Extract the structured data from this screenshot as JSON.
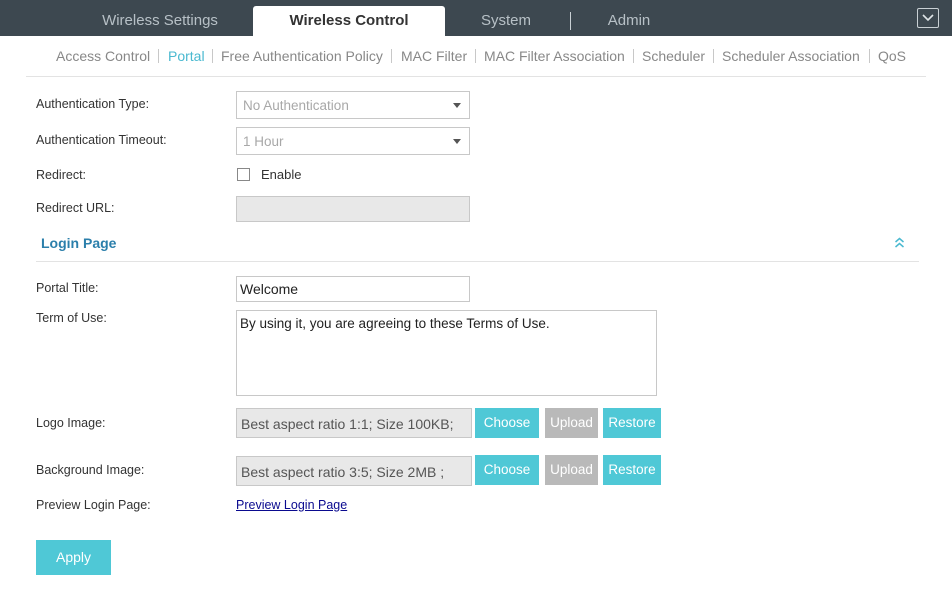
{
  "tabs": [
    {
      "label": "Wireless Settings"
    },
    {
      "label": "Wireless Control"
    },
    {
      "label": "System"
    },
    {
      "label": "Admin"
    }
  ],
  "subnav": [
    {
      "label": "Access Control"
    },
    {
      "label": "Portal"
    },
    {
      "label": "Free Authentication Policy"
    },
    {
      "label": "MAC Filter"
    },
    {
      "label": "MAC Filter Association"
    },
    {
      "label": "Scheduler"
    },
    {
      "label": "Scheduler Association"
    },
    {
      "label": "QoS"
    }
  ],
  "active_tab": "Wireless Control",
  "active_subnav": "Portal",
  "form": {
    "auth_type": {
      "label": "Authentication Type:",
      "value": "No Authentication"
    },
    "auth_timeout": {
      "label": "Authentication Timeout:",
      "value": "1 Hour"
    },
    "redirect": {
      "label": "Redirect:",
      "checkbox_label": "Enable",
      "checked": false
    },
    "redirect_url": {
      "label": "Redirect URL:",
      "value": ""
    }
  },
  "login_page": {
    "title": "Login Page",
    "portal_title": {
      "label": "Portal Title:",
      "value": "Welcome"
    },
    "term_of_use": {
      "label": "Term of Use:",
      "value": "By using it, you are agreeing to these Terms of Use."
    },
    "logo_image": {
      "label": "Logo Image:",
      "hint": "Best aspect ratio 1:1; Size 100KB;"
    },
    "background_image": {
      "label": "Background Image:",
      "hint": "Best aspect ratio 3:5; Size 2MB ;"
    },
    "preview": {
      "label": "Preview Login Page:",
      "link": "Preview Login Page"
    }
  },
  "buttons": {
    "choose": "Choose",
    "upload": "Upload",
    "restore": "Restore",
    "apply": "Apply"
  },
  "colors": {
    "topbar": "#3d4850",
    "accent": "#4fc8d6",
    "section_title": "#2b7fab",
    "disabled_button": "#b9b9b9"
  },
  "icons": {
    "menu": "chevron-down-icon",
    "collapse": "double-chevron-up-icon"
  }
}
